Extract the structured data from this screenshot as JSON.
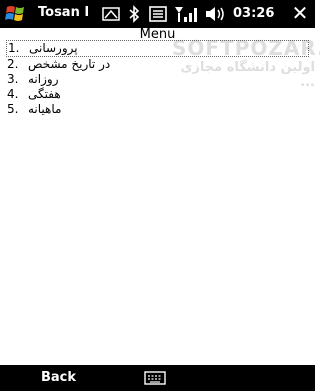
{
  "statusbar": {
    "app_title": "Tosan I",
    "time": "03:26",
    "icons": [
      "windows-start-icon",
      "connectivity-icon",
      "bluetooth-icon",
      "notes-icon",
      "signal-icon",
      "volume-icon",
      "close-icon"
    ]
  },
  "menu": {
    "title": "Menu",
    "items": [
      {
        "number": "1.",
        "label": "پرورسانی"
      },
      {
        "number": "2.",
        "label": "در تاریخ مشخص"
      },
      {
        "number": "3.",
        "label": "روزانه"
      },
      {
        "number": "4.",
        "label": "هفتگی"
      },
      {
        "number": "5.",
        "label": "ماهیانه"
      }
    ]
  },
  "watermark": {
    "line1": "SOFTPOZAR.COM",
    "line2": "اولین دانشگاه مجازی ..."
  },
  "softbar": {
    "left_label": "Back"
  },
  "colors": {
    "bar_bg": "#000000",
    "text": "#000000",
    "background": "#ffffff"
  }
}
